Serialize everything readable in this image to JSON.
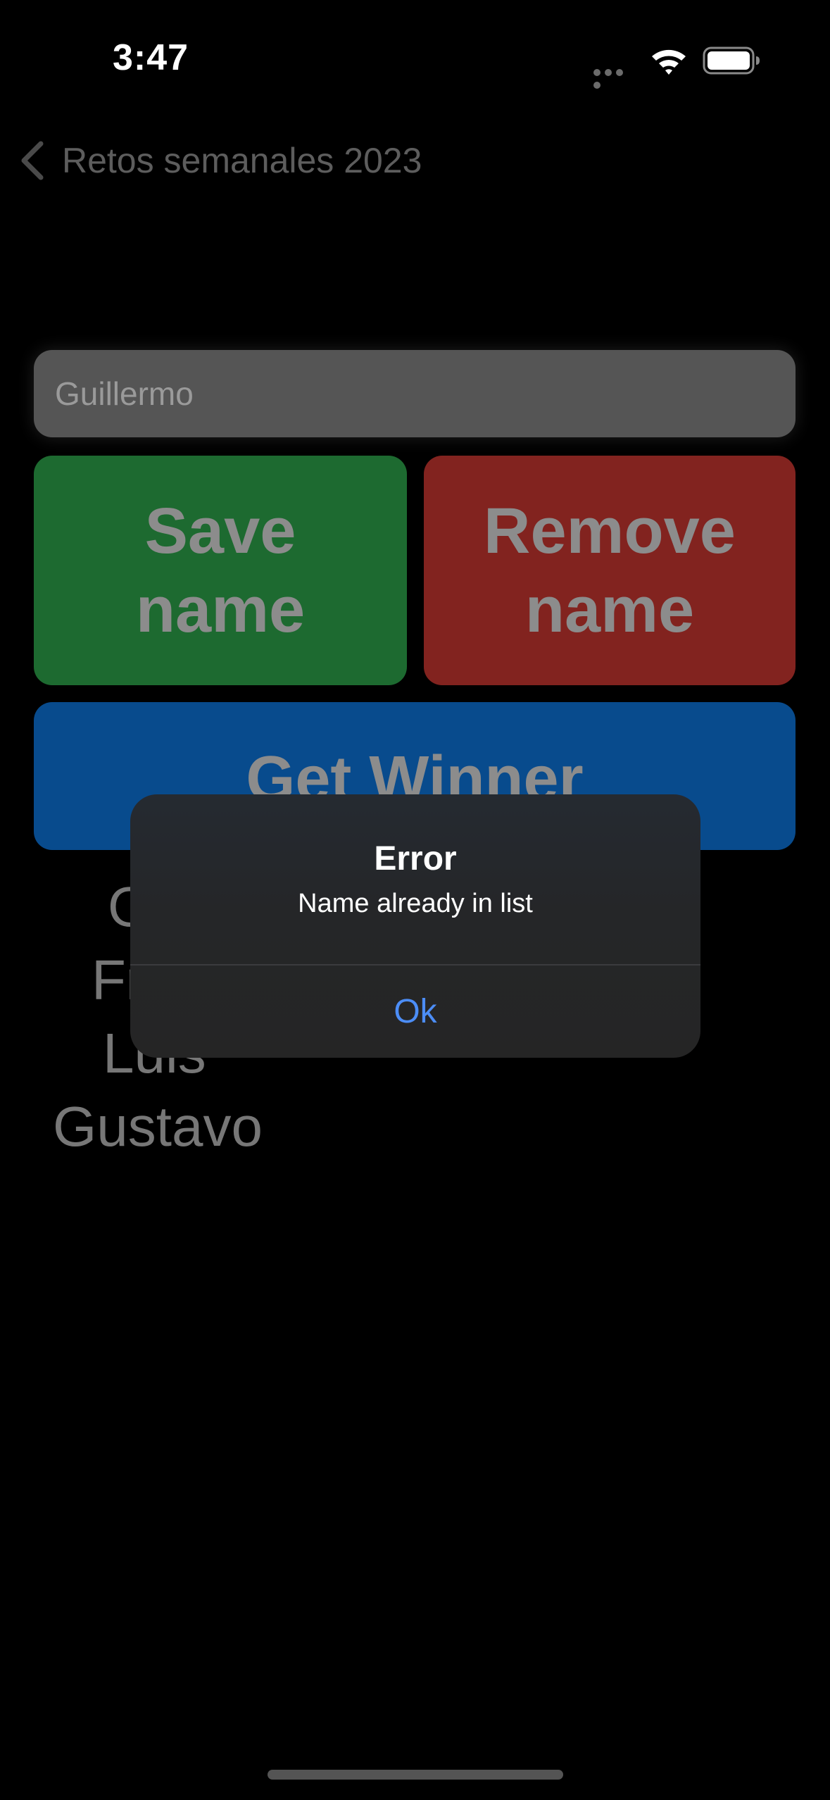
{
  "status_bar": {
    "time": "3:47",
    "icons": [
      "signal-dots-icon",
      "wifi-icon",
      "battery-icon"
    ]
  },
  "nav": {
    "back_title": "Retos semanales 2023"
  },
  "form": {
    "input_value": "Guillermo",
    "save_label": "Save name",
    "remove_label": "Remove name",
    "winner_label": "Get Winner"
  },
  "names": [
    "Guil",
    "Fr",
    "Luis",
    "Gustavo"
  ],
  "alert": {
    "title": "Error",
    "message": "Name already in list",
    "ok_label": "Ok"
  },
  "colors": {
    "background": "#000000",
    "save_button": "#1d6a30",
    "remove_button": "#82231f",
    "winner_button": "#084b8d",
    "alert_accent": "#4c8df6"
  }
}
